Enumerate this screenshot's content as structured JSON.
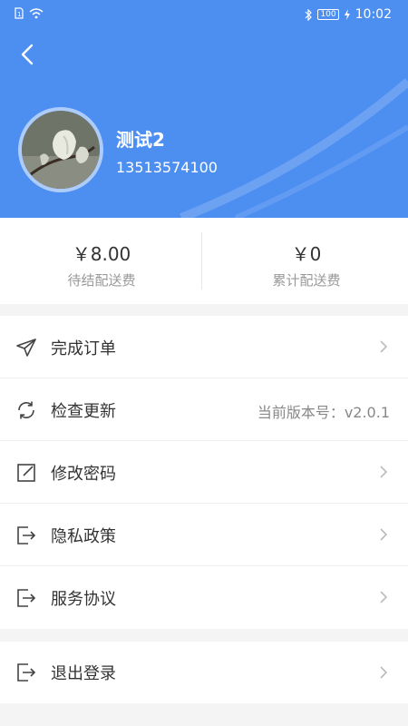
{
  "status_bar": {
    "time": "10:02",
    "battery": "100",
    "icons": [
      "sim-icon",
      "wifi-icon",
      "bluetooth-icon",
      "battery-icon",
      "charging-icon"
    ]
  },
  "header": {
    "background_color": "#4d8ef1",
    "back_icon": "chevron-left-icon"
  },
  "profile": {
    "name": "测试2",
    "phone": "13513574100"
  },
  "stats": [
    {
      "value": "￥8.00",
      "label": "待结配送费"
    },
    {
      "value": "￥0",
      "label": "累计配送费"
    }
  ],
  "menu": [
    {
      "label": "完成订单",
      "icon": "paper-plane-icon"
    },
    {
      "label": "检查更新",
      "icon": "refresh-icon",
      "right_text": "当前版本号：v2.0.1"
    },
    {
      "label": "修改密码",
      "icon": "edit-icon"
    },
    {
      "label": "隐私政策",
      "icon": "exit-box-icon"
    },
    {
      "label": "服务协议",
      "icon": "exit-box-icon"
    }
  ],
  "logout": {
    "label": "退出登录",
    "icon": "exit-box-icon"
  }
}
